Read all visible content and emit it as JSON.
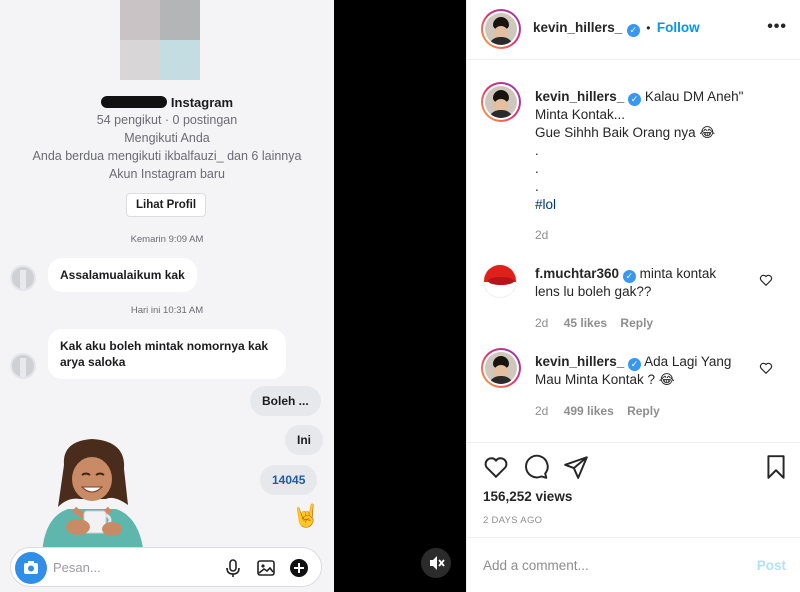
{
  "dm": {
    "profile_name_suffix": "Instagram",
    "profile_stats": "54 pengikut · 0 postingan",
    "follows_you": "Mengikuti Anda",
    "mutuals": "Anda berdua mengikuti ikbalfauzi_ dan 6 lainnya",
    "new_account": "Akun Instagram baru",
    "view_profile_label": "Lihat Profil",
    "timestamp_1": "Kemarin 9:09 AM",
    "message_1": "Assalamualaikum kak",
    "timestamp_2": "Hari ini 10:31 AM",
    "message_2": "Kak aku boleh mintak nomornya kak arya saloka",
    "reply_1": "Boleh ...",
    "reply_2": "Ini",
    "reply_3": "14045",
    "reply_emoji": "🤘",
    "input_placeholder": "Pesan..."
  },
  "post": {
    "header": {
      "username": "kevin_hillers_",
      "separator": "•",
      "follow_label": "Follow",
      "more_label": "•••"
    },
    "caption": {
      "username": "kevin_hillers_",
      "line_1": "Kalau DM Aneh\"",
      "line_2": "Minta Kontak...",
      "line_3": "Gue Sihhh Baik Orang nya 😂",
      "dot_1": ".",
      "dot_2": ".",
      "dot_3": ".",
      "hashtag": "#lol",
      "age": "2d"
    },
    "comments": [
      {
        "username": "f.muchtar360",
        "text_1": "minta kontak",
        "text_2": "lens lu boleh gak??",
        "age": "2d",
        "likes": "45 likes",
        "reply_label": "Reply"
      },
      {
        "username": "kevin_hillers_",
        "text_1": "Ada Lagi Yang",
        "text_2": "Mau Minta Kontak ? 😂",
        "age": "2d",
        "likes": "499 likes",
        "reply_label": "Reply"
      }
    ],
    "views": "156,252 views",
    "posted_ago": "2 DAYS AGO",
    "add_comment_placeholder": "Add a comment...",
    "post_label": "Post"
  },
  "icons": {
    "verified_badge": "verified-icon",
    "like": "heart-icon",
    "comment": "comment-icon",
    "share": "paper-plane-icon",
    "save": "bookmark-icon",
    "mute": "speaker-muted-icon",
    "camera": "camera-icon",
    "microphone": "microphone-icon",
    "gallery": "image-icon",
    "add": "plus-circle-icon"
  },
  "colors": {
    "link_blue": "#0095f6",
    "verified_blue": "#3897f0",
    "hashtag": "#00376b",
    "muted_text": "#8e8e8e",
    "dm_bg": "#f4f4f6"
  }
}
